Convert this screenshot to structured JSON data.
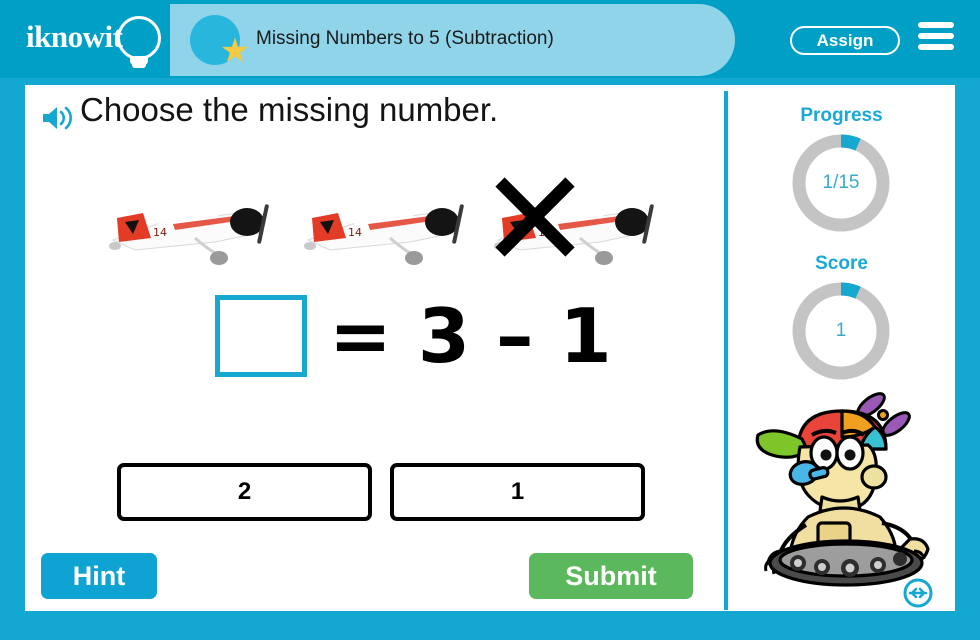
{
  "header": {
    "logo_text": "iknowit",
    "logo_icon": "lightbulb-icon",
    "lesson_title": "Missing Numbers to 5 (Subtraction)",
    "star_icon": "star-icon",
    "assign_label": "Assign",
    "menu_icon": "hamburger-menu-icon"
  },
  "content": {
    "audio_icon": "speaker-icon",
    "instruction": "Choose the missing number.",
    "manipulatives": {
      "item_icon": "airplane-icon",
      "total_count": 3,
      "crossed_out_count": 1,
      "cross_icon": "x-cross-icon"
    },
    "equation": {
      "blank_label": "",
      "equals": "=",
      "minuend": "3",
      "operator": "–",
      "subtrahend": "1"
    },
    "answers": [
      {
        "label": "2"
      },
      {
        "label": "1"
      }
    ],
    "hint_label": "Hint",
    "submit_label": "Submit"
  },
  "sidebar": {
    "progress": {
      "label": "Progress",
      "value_text": "1/15",
      "current": 1,
      "total": 15
    },
    "score": {
      "label": "Score",
      "value_text": "1",
      "current": 1,
      "total": 15
    },
    "mascot_icon": "robot-mascot-icon",
    "resize_icon": "resize-horizontal-icon"
  },
  "colors": {
    "brand_blue": "#00a0c6",
    "frame_blue": "#12a8d2",
    "pill_blue": "#8fd4e8",
    "star_yellow": "#f6c943",
    "accent_cyan": "#17a8d0",
    "submit_green": "#5cb85c",
    "gauge_track": "#c4c4c4"
  }
}
